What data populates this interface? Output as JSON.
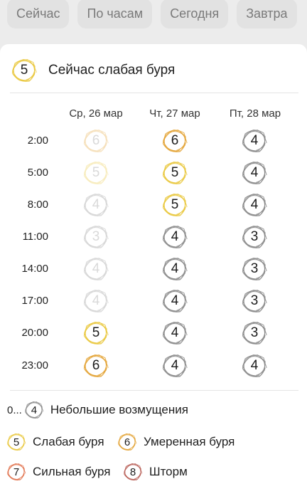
{
  "tabs": [
    "Сейчас",
    "По часам",
    "Сегодня",
    "Завтра"
  ],
  "colors": {
    "calm": "#8a8a8a",
    "weak": "#e9c73b",
    "moderate": "#e3a233",
    "strong": "#e0704a",
    "storm": "#b65a52"
  },
  "current": {
    "value": "5",
    "level": "weak",
    "text": "Сейчас слабая буря"
  },
  "days": [
    "Ср, 26 мар",
    "Чт, 27 мар",
    "Пт, 28 мар"
  ],
  "times": [
    "2:00",
    "5:00",
    "8:00",
    "11:00",
    "14:00",
    "17:00",
    "20:00",
    "23:00"
  ],
  "grid": [
    [
      {
        "v": "6",
        "lv": "moderate",
        "faded": true
      },
      {
        "v": "6",
        "lv": "moderate",
        "faded": false
      },
      {
        "v": "4",
        "lv": "calm",
        "faded": false
      }
    ],
    [
      {
        "v": "5",
        "lv": "weak",
        "faded": true
      },
      {
        "v": "5",
        "lv": "weak",
        "faded": false
      },
      {
        "v": "4",
        "lv": "calm",
        "faded": false
      }
    ],
    [
      {
        "v": "4",
        "lv": "calm",
        "faded": true
      },
      {
        "v": "5",
        "lv": "weak",
        "faded": false
      },
      {
        "v": "4",
        "lv": "calm",
        "faded": false
      }
    ],
    [
      {
        "v": "3",
        "lv": "calm",
        "faded": true
      },
      {
        "v": "4",
        "lv": "calm",
        "faded": false
      },
      {
        "v": "3",
        "lv": "calm",
        "faded": false
      }
    ],
    [
      {
        "v": "4",
        "lv": "calm",
        "faded": true
      },
      {
        "v": "4",
        "lv": "calm",
        "faded": false
      },
      {
        "v": "3",
        "lv": "calm",
        "faded": false
      }
    ],
    [
      {
        "v": "4",
        "lv": "calm",
        "faded": true
      },
      {
        "v": "4",
        "lv": "calm",
        "faded": false
      },
      {
        "v": "3",
        "lv": "calm",
        "faded": false
      }
    ],
    [
      {
        "v": "5",
        "lv": "weak",
        "faded": false
      },
      {
        "v": "4",
        "lv": "calm",
        "faded": false
      },
      {
        "v": "3",
        "lv": "calm",
        "faded": false
      }
    ],
    [
      {
        "v": "6",
        "lv": "moderate",
        "faded": false
      },
      {
        "v": "4",
        "lv": "calm",
        "faded": false
      },
      {
        "v": "4",
        "lv": "calm",
        "faded": false
      }
    ]
  ],
  "legend": {
    "calm": {
      "prefix": "0...",
      "value": "4",
      "label": "Небольшие возмущения"
    },
    "weak": {
      "value": "5",
      "label": "Слабая буря"
    },
    "moderate": {
      "value": "6",
      "label": "Умеренная буря"
    },
    "strong": {
      "value": "7",
      "label": "Сильная буря"
    },
    "storm": {
      "value": "8",
      "label": "Шторм"
    }
  }
}
